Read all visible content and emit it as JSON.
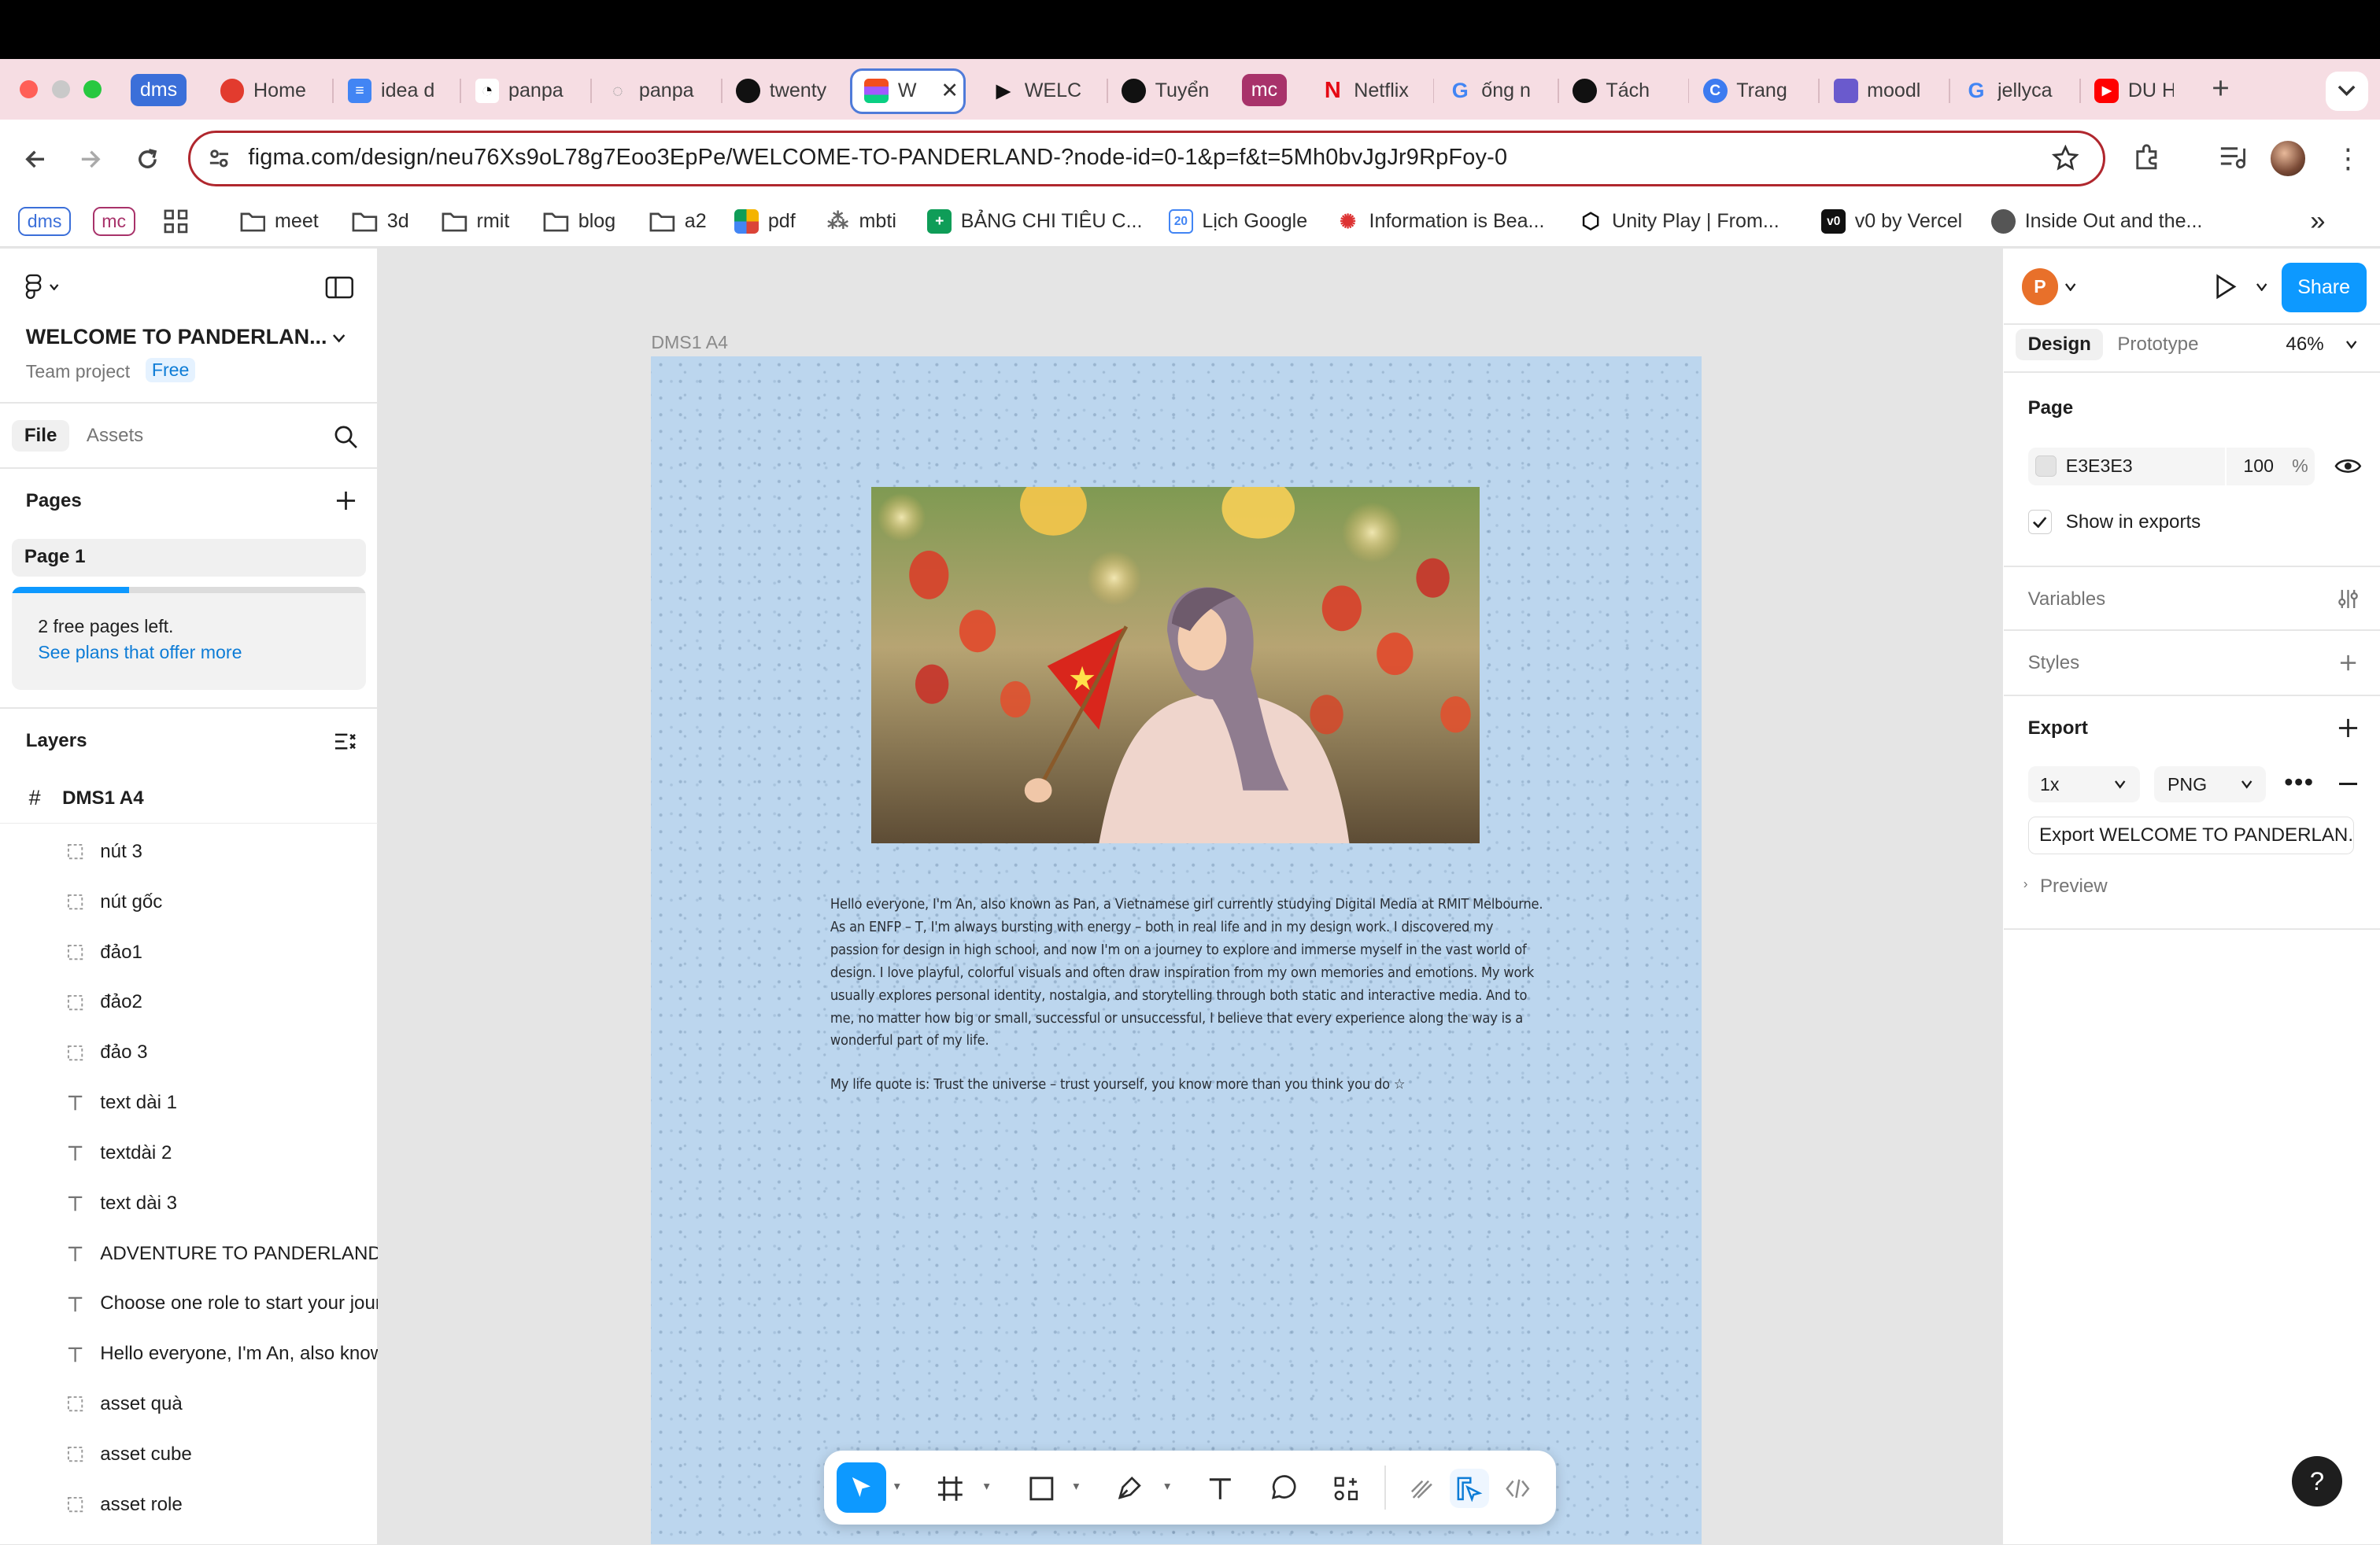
{
  "browser": {
    "tabs": [
      {
        "label": "dms",
        "kind": "group",
        "color": "#3b6fd9"
      },
      {
        "label": "Home",
        "icon": "red-app-icon"
      },
      {
        "label": "idea d",
        "icon": "docs-icon"
      },
      {
        "label": "panpa",
        "icon": "spiral-icon"
      },
      {
        "label": "panpa",
        "icon": "circle-icon"
      },
      {
        "label": "twenty",
        "icon": "github-icon"
      },
      {
        "label": "W",
        "icon": "figma-icon",
        "active": true
      },
      {
        "label": "WELC",
        "icon": "play-icon"
      },
      {
        "label": "Tuyển",
        "icon": "openai-icon"
      },
      {
        "label": "mc",
        "kind": "group",
        "color": "#a8326a"
      },
      {
        "label": "Netflix",
        "icon": "netflix-icon"
      },
      {
        "label": "ống n",
        "icon": "google-icon"
      },
      {
        "label": "Tách",
        "icon": "openai-icon"
      },
      {
        "label": "Trang",
        "icon": "c-icon"
      },
      {
        "label": "moodl",
        "icon": "moodle-icon"
      },
      {
        "label": "jellyca",
        "icon": "google-icon"
      },
      {
        "label": "DU HỌ",
        "icon": "youtube-icon"
      }
    ],
    "new_tab": "+",
    "url": "figma.com/design/neu76Xs9oL78g7Eoo3EpPe/WELCOME-TO-PANDERLAND-?node-id=0-1&p=f&t=5Mh0bvJgJr9RpFoy-0",
    "bookmarks": [
      {
        "label": "dms",
        "kind": "badge",
        "color": "#3b6fd9"
      },
      {
        "label": "mc",
        "kind": "badge",
        "color": "#a8326a"
      },
      {
        "label": "",
        "kind": "apps"
      },
      {
        "label": "meet",
        "icon": "folder-icon"
      },
      {
        "label": "3d",
        "icon": "folder-icon"
      },
      {
        "label": "rmit",
        "icon": "folder-icon"
      },
      {
        "label": "blog",
        "icon": "folder-icon"
      },
      {
        "label": "a2",
        "icon": "folder-icon"
      },
      {
        "label": "pdf",
        "icon": "color-grid-icon"
      },
      {
        "label": "mbti",
        "icon": "dots-icon"
      },
      {
        "label": "BẢNG CHI TIÊU C...",
        "icon": "sheets-icon"
      },
      {
        "label": "Lịch Google",
        "icon": "calendar-icon"
      },
      {
        "label": "Information is Bea...",
        "icon": "sun-icon"
      },
      {
        "label": "Unity Play | From...",
        "icon": "unity-icon"
      },
      {
        "label": "v0 by Vercel",
        "icon": "v0-icon"
      },
      {
        "label": "Inside Out and the...",
        "icon": "globe-icon"
      }
    ],
    "more_bookmarks": "»"
  },
  "left_panel": {
    "file_title": "WELCOME TO PANDERLAN...",
    "team": "Team project",
    "plan_badge": "Free",
    "tab_file": "File",
    "tab_assets": "Assets",
    "pages_heading": "Pages",
    "pages": [
      "Page 1"
    ],
    "free_pages_text": "2 free pages left.",
    "see_plans": "See plans that offer more",
    "free_pages_used_fraction": 0.33,
    "layers_heading": "Layers",
    "root_layer": "DMS1 A4",
    "layers": [
      {
        "name": "nút 3",
        "type": "group"
      },
      {
        "name": "nút gốc",
        "type": "group"
      },
      {
        "name": "đảo1",
        "type": "group"
      },
      {
        "name": "đảo2",
        "type": "group"
      },
      {
        "name": "đảo 3",
        "type": "group"
      },
      {
        "name": "text dài 1",
        "type": "text"
      },
      {
        "name": "textdài 2",
        "type": "text"
      },
      {
        "name": "text dài 3",
        "type": "text"
      },
      {
        "name": "ADVENTURE TO PANDERLAND!",
        "type": "text"
      },
      {
        "name": "Choose one role to start your journey",
        "type": "text"
      },
      {
        "name": "Hello everyone, I'm An, also known as Pan",
        "type": "text"
      },
      {
        "name": "asset quà",
        "type": "group"
      },
      {
        "name": "asset cube",
        "type": "group"
      },
      {
        "name": "asset role",
        "type": "group"
      }
    ]
  },
  "canvas": {
    "frame_label": "DMS1 A4",
    "intro_lines": [
      "Hello everyone, I'm An, also known as Pan, a Vietnamese girl currently studying Digital Media at RMIT Melbourne.",
      "As an ENFP – T, I'm always bursting with energy – both in real life and in my design work. I discovered my",
      "passion for design in high school, and now I'm on a journey to explore and immerse myself in the vast world of",
      "design. I love playful, colorful visuals and often draw inspiration from my own memories and emotions. My work",
      "usually explores personal identity, nostalgia, and storytelling through both static and interactive media. And to",
      "me, no matter how big or small, successful or unsuccessful, I believe that every experience along the way is a",
      "wonderful part of my life."
    ],
    "quote": "My life quote is: Trust the universe – trust yourself, you know more than you think you do ☆"
  },
  "right_panel": {
    "avatar_letter": "P",
    "share": "Share",
    "tab_design": "Design",
    "tab_prototype": "Prototype",
    "zoom": "46%",
    "page_heading": "Page",
    "page_color": "E3E3E3",
    "page_opacity": "100",
    "percent": "%",
    "show_in_exports": "Show in exports",
    "variables": "Variables",
    "styles": "Styles",
    "export_heading": "Export",
    "export_scale": "1x",
    "export_format": "PNG",
    "export_button": "Export WELCOME TO PANDERLAN...",
    "preview": "Preview",
    "help": "?"
  },
  "colors": {
    "accent": "#0d99ff",
    "share": "#0d99ff",
    "avatar": "#e8702a",
    "url_outline": "#b0272e",
    "tab_strip": "#f6dde3",
    "frame_bg": "#bcd6ee"
  }
}
